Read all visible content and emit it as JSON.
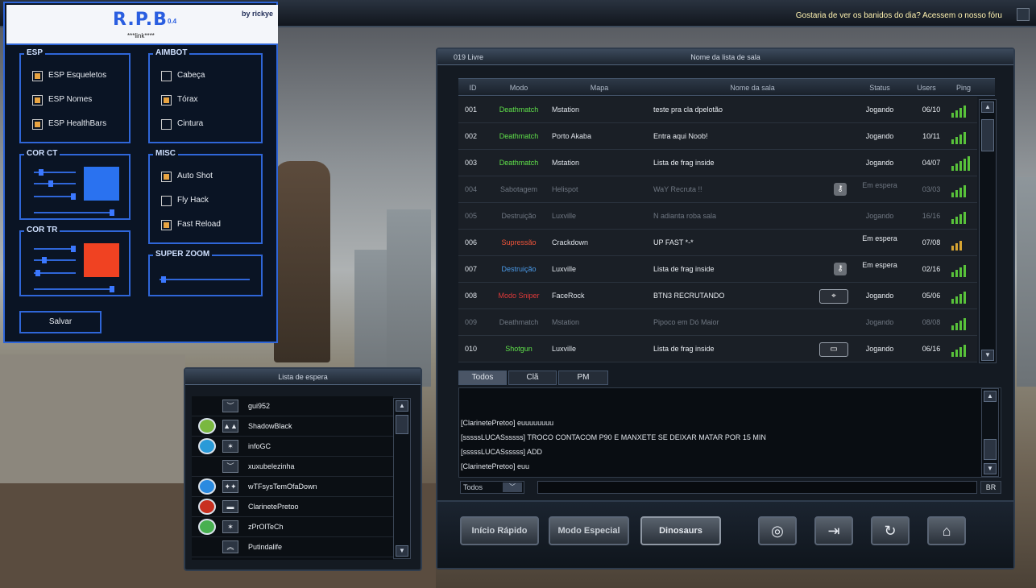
{
  "marquee": "Gostaria de ver os banidos do dia? Acessem o nosso fóru",
  "hack": {
    "title": "R.P.B",
    "version": "0.4",
    "byline": "by rickye",
    "link": "***link****",
    "save_label": "Salvar",
    "esp": {
      "title": "ESP",
      "options": [
        {
          "label": "ESP Esqueletos",
          "checked": true
        },
        {
          "label": "ESP Nomes",
          "checked": true
        },
        {
          "label": "ESP HealthBars",
          "checked": true
        }
      ]
    },
    "aimbot": {
      "title": "AIMBOT",
      "options": [
        {
          "label": "Cabeça",
          "checked": false
        },
        {
          "label": "Tórax",
          "checked": true
        },
        {
          "label": "Cintura",
          "checked": false
        }
      ]
    },
    "misc": {
      "title": "MISC",
      "options": [
        {
          "label": "Auto Shot",
          "checked": true
        },
        {
          "label": "Fly Hack",
          "checked": false
        },
        {
          "label": "Fast Reload",
          "checked": true
        }
      ]
    },
    "cor_ct": {
      "title": "COR CT",
      "color": "#2a72f0"
    },
    "cor_tr": {
      "title": "COR TR",
      "color": "#f04222"
    },
    "super_zoom": {
      "title": "SUPER ZOOM"
    }
  },
  "room": {
    "header_left": "019 Livre",
    "header_center": "Nome da lista de sala",
    "columns": [
      "ID",
      "Modo",
      "Mapa",
      "Nome da sala",
      "Status",
      "Users",
      "Ping"
    ],
    "rows": [
      {
        "id": "001",
        "mode": "Deathmatch",
        "mode_color": "#5fe04a",
        "map": "Mstation",
        "name": "teste pra cla dpelotão",
        "status": "Jogando",
        "users": "06/10",
        "dim": false,
        "ping": 4,
        "ping_color": "#58c23a",
        "icon": ""
      },
      {
        "id": "002",
        "mode": "Deathmatch",
        "mode_color": "#5fe04a",
        "map": "Porto Akaba",
        "name": "Entra aqui Noob!",
        "status": "Jogando",
        "users": "10/11",
        "dim": false,
        "ping": 4,
        "ping_color": "#58c23a",
        "icon": ""
      },
      {
        "id": "003",
        "mode": "Deathmatch",
        "mode_color": "#5fe04a",
        "map": "Mstation",
        "name": "Lista de frag inside",
        "status": "Jogando",
        "users": "04/07",
        "dim": false,
        "ping": 5,
        "ping_color": "#58c23a",
        "icon": ""
      },
      {
        "id": "004",
        "mode": "Sabotagem",
        "mode_color": "#c66bd8",
        "map": "Helispot",
        "name": "WaY   Recruta !!",
        "status": "Em espera",
        "users": "03/03",
        "dim": true,
        "ping": 4,
        "ping_color": "#58c23a",
        "icon": "key-icon"
      },
      {
        "id": "005",
        "mode": "Destruição",
        "mode_color": "#4a9ae8",
        "map": "Luxville",
        "name": "N adianta roba sala",
        "status": "Jogando",
        "users": "16/16",
        "dim": true,
        "ping": 4,
        "ping_color": "#58c23a",
        "icon": ""
      },
      {
        "id": "006",
        "mode": "Supressão",
        "mode_color": "#f0553a",
        "map": "Crackdown",
        "name": " UP FAST *-*",
        "status": "Em espera",
        "users": "07/08",
        "dim": false,
        "ping": 3,
        "ping_color": "#d8a532",
        "icon": ""
      },
      {
        "id": "007",
        "mode": "Destruição",
        "mode_color": "#4a9ae8",
        "map": "Luxville",
        "name": "Lista de frag inside",
        "status": "Em espera",
        "users": "02/16",
        "dim": false,
        "ping": 4,
        "ping_color": "#58c23a",
        "icon": "key-icon"
      },
      {
        "id": "008",
        "mode": "Modo Sniper",
        "mode_color": "#e03a3a",
        "map": "FaceRock",
        "name": "BTN3 RECRUTANDO",
        "status": "Jogando",
        "users": "05/06",
        "dim": false,
        "ping": 4,
        "ping_color": "#58c23a",
        "icon": "crosshair-icon"
      },
      {
        "id": "009",
        "mode": "Deathmatch",
        "mode_color": "#5fe04a",
        "map": "Mstation",
        "name": "Pipoco em Dó Maior",
        "status": "Jogando",
        "users": "08/08",
        "dim": true,
        "ping": 4,
        "ping_color": "#58c23a",
        "icon": ""
      },
      {
        "id": "010",
        "mode": "Shotgun",
        "mode_color": "#5fe04a",
        "map": "Luxville",
        "name": "Lista de frag inside",
        "status": "Jogando",
        "users": "06/16",
        "dim": false,
        "ping": 4,
        "ping_color": "#58c23a",
        "icon": "shotgun-icon"
      }
    ]
  },
  "chat": {
    "tabs": [
      "Todos",
      "Clã",
      "PM"
    ],
    "lines": [
      "[ClarinetePretoo] euuuuuuuu",
      "[sssssLUCASsssss] TROCO CONTACOM P90 E MANXETE SE DEIXAR MATAR POR 15 MIN",
      "[sssssLUCASsssss] ADD",
      "[ClarinetePretoo] euu"
    ],
    "channel": "Todos",
    "lang": "BR"
  },
  "buttons": {
    "quick": "Início Rápido",
    "special": "Modo Especial",
    "dino": "Dinosaurs"
  },
  "waitlist": {
    "title": "Lista de espera",
    "players": [
      {
        "name": "gui952",
        "badge": "",
        "rank": "︶"
      },
      {
        "name": "ShadowBlack",
        "badge": "#7ab840",
        "rank": "▲▲"
      },
      {
        "name": "infoGC",
        "badge": "#2a9ad8",
        "rank": "✶"
      },
      {
        "name": "xuxubelezinha",
        "badge": "",
        "rank": "︶"
      },
      {
        "name": "wTFsysTemOfaDown",
        "badge": "#2a8ae0",
        "rank": "✦✦"
      },
      {
        "name": "ClarinetePretoo",
        "badge": "#c83020",
        "rank": "▬"
      },
      {
        "name": "zPrOlTeCh",
        "badge": "#48b050",
        "rank": "✶"
      },
      {
        "name": "Putindalife",
        "badge": "",
        "rank": "︽"
      }
    ]
  }
}
